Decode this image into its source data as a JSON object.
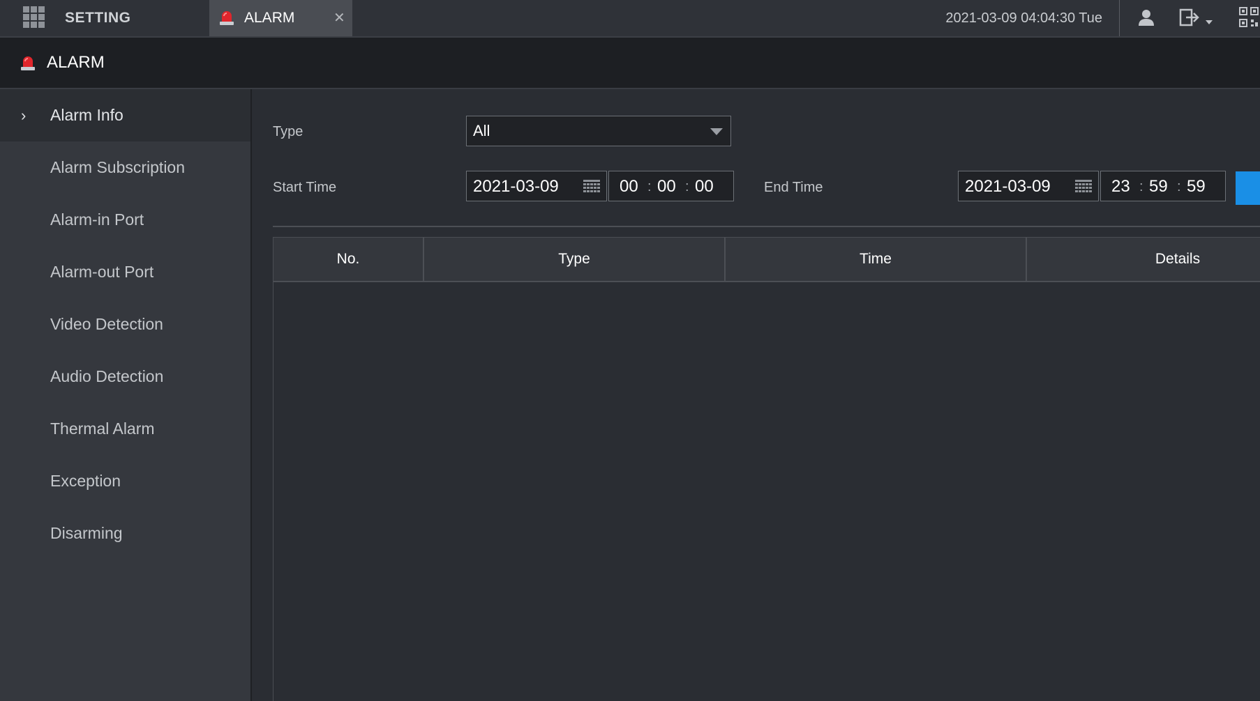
{
  "topbar": {
    "setting_label": "SETTING",
    "tab_label": "ALARM",
    "tab_close": "✕",
    "datetime": "2021-03-09 04:04:30 Tue"
  },
  "header": {
    "title": "ALARM"
  },
  "sidebar": {
    "active_chevron": "›",
    "items": [
      {
        "label": "Alarm Info"
      },
      {
        "label": "Alarm Subscription"
      },
      {
        "label": "Alarm-in Port"
      },
      {
        "label": "Alarm-out Port"
      },
      {
        "label": "Video Detection"
      },
      {
        "label": "Audio Detection"
      },
      {
        "label": "Thermal Alarm"
      },
      {
        "label": "Exception"
      },
      {
        "label": "Disarming"
      }
    ]
  },
  "filters": {
    "type_label": "Type",
    "type_value": "All",
    "start_label": "Start Time",
    "start_date": "2021-03-09",
    "start_hh": "00",
    "start_mm": "00",
    "start_ss": "00",
    "end_label": "End Time",
    "end_date": "2021-03-09",
    "end_hh": "23",
    "end_mm": "59",
    "end_ss": "59",
    "time_sep": ":"
  },
  "table": {
    "columns": [
      "No.",
      "Type",
      "Time",
      "Details"
    ],
    "rows": []
  },
  "colors": {
    "accent": "#1a8fe6",
    "alarm_red": "#e0262c",
    "background": "#2a2d33",
    "sidebar": "#35383e"
  },
  "icons": {
    "menu": "grid-menu-icon",
    "alarm": "alarm-siren-icon",
    "close": "close-icon",
    "user": "user-icon",
    "logout": "logout-icon",
    "qr": "qr-code-icon",
    "calendar": "calendar-icon",
    "dropdown": "chevron-down-icon",
    "active": "chevron-right-icon"
  }
}
